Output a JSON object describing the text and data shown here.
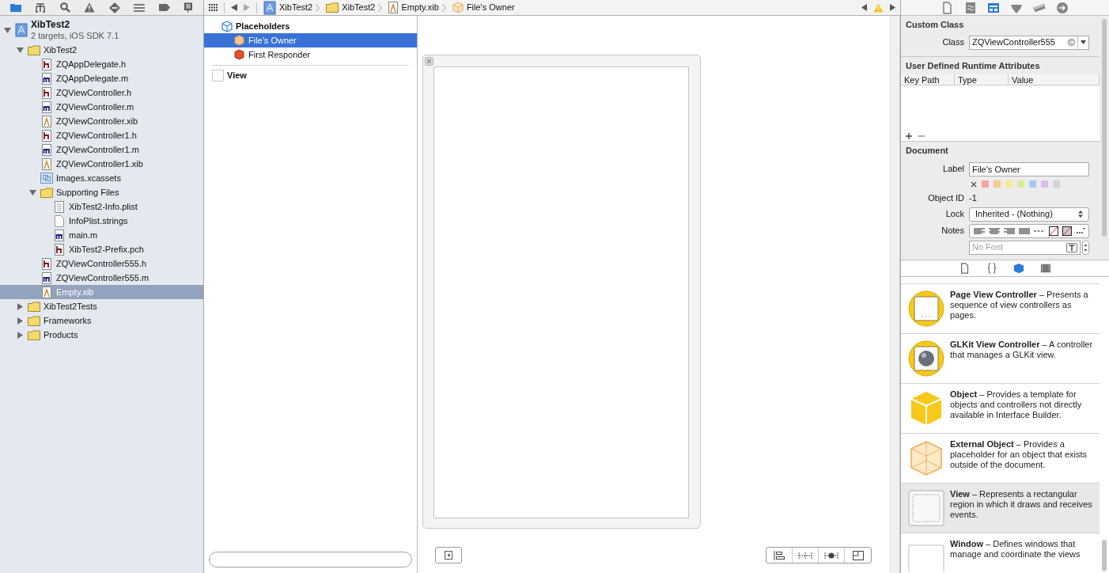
{
  "navigator": {
    "tree": [
      {
        "name": "XibTest2",
        "subtitle": "2 targets, iOS SDK 7.1",
        "kind": "project",
        "expanded": true,
        "selected": false,
        "children": [
          {
            "name": "XibTest2",
            "kind": "folder",
            "expanded": true,
            "selected": false,
            "children": [
              {
                "name": "ZQAppDelegate.h",
                "kind": "h",
                "selected": false
              },
              {
                "name": "ZQAppDelegate.m",
                "kind": "m",
                "selected": false
              },
              {
                "name": "ZQViewController.h",
                "kind": "h",
                "selected": false
              },
              {
                "name": "ZQViewController.m",
                "kind": "m",
                "selected": false
              },
              {
                "name": "ZQViewController.xib",
                "kind": "xib",
                "selected": false
              },
              {
                "name": "ZQViewController1.h",
                "kind": "h",
                "selected": false
              },
              {
                "name": "ZQViewController1.m",
                "kind": "m",
                "selected": false
              },
              {
                "name": "ZQViewController1.xib",
                "kind": "xib",
                "selected": false
              },
              {
                "name": "Images.xcassets",
                "kind": "assets",
                "selected": false
              },
              {
                "name": "Supporting Files",
                "kind": "folder",
                "expanded": true,
                "selected": false,
                "children": [
                  {
                    "name": "XibTest2-Info.plist",
                    "kind": "plist",
                    "selected": false
                  },
                  {
                    "name": "InfoPlist.strings",
                    "kind": "strings",
                    "selected": false
                  },
                  {
                    "name": "main.m",
                    "kind": "m",
                    "selected": false
                  },
                  {
                    "name": "XibTest2-Prefix.pch",
                    "kind": "h",
                    "selected": false
                  }
                ]
              },
              {
                "name": "ZQViewController555.h",
                "kind": "h",
                "selected": false
              },
              {
                "name": "ZQViewController555.m",
                "kind": "m",
                "selected": false
              },
              {
                "name": "Empty.xib",
                "kind": "xib",
                "selected": true
              }
            ]
          },
          {
            "name": "XibTest2Tests",
            "kind": "folder",
            "expanded": false,
            "selected": false
          },
          {
            "name": "Frameworks",
            "kind": "folder",
            "expanded": false,
            "selected": false
          },
          {
            "name": "Products",
            "kind": "folder",
            "expanded": false,
            "selected": false
          }
        ]
      }
    ]
  },
  "jump_bar": {
    "crumbs": [
      {
        "label": "XibTest2",
        "kind": "project"
      },
      {
        "label": "XibTest2",
        "kind": "folder"
      },
      {
        "label": "Empty.xib",
        "kind": "xib"
      },
      {
        "label": "File's Owner",
        "kind": "owner"
      }
    ]
  },
  "outline": {
    "sections": [
      {
        "title": "Placeholders",
        "kind": "placeholders",
        "items": [
          {
            "label": "File's Owner",
            "kind": "owner",
            "selected": true
          },
          {
            "label": "First Responder",
            "kind": "responder",
            "selected": false
          }
        ]
      },
      {
        "title": "View",
        "kind": "view"
      }
    ]
  },
  "inspector": {
    "tabs": [
      {
        "selected": false
      },
      {
        "selected": false
      },
      {
        "selected": true
      },
      {
        "selected": false
      },
      {
        "selected": false
      },
      {
        "selected": false
      }
    ],
    "custom_class": {
      "title": "Custom Class",
      "class_label": "Class",
      "class_value": "ZQViewController555"
    },
    "runtime_attributes": {
      "title": "User Defined Runtime Attributes",
      "columns": [
        "Key Path",
        "Type",
        "Value"
      ]
    },
    "document": {
      "title": "Document",
      "label_label": "Label",
      "label_value": "File's Owner",
      "label_colors": [
        {
          "color": "#f4a3a3"
        },
        {
          "color": "#f8c98f"
        },
        {
          "color": "#f3ec92"
        },
        {
          "color": "#d5e99b"
        },
        {
          "color": "#a0cbf4"
        },
        {
          "color": "#dcbdef"
        },
        {
          "color": "#d4d4d4"
        }
      ],
      "object_id_label": "Object ID",
      "object_id": "-1",
      "lock_label": "Lock",
      "lock_value": "Inherited - (Nothing)",
      "notes_label": "Notes",
      "font_placeholder": "No Font"
    }
  },
  "library": {
    "tabs": [
      {
        "selected": false
      },
      {
        "selected": false
      },
      {
        "selected": true
      },
      {
        "selected": false
      }
    ],
    "items": [
      {
        "title": "Page View Controller",
        "description": "– Presents a sequence of view controllers as pages.",
        "kind": "page",
        "selected": false
      },
      {
        "title": "GLKit View Controller",
        "description": "– A controller that manages a GLKit view.",
        "kind": "glkit",
        "selected": false
      },
      {
        "title": "Object",
        "description": "– Provides a template for objects and controllers not directly available in Interface Builder.",
        "kind": "object",
        "selected": false
      },
      {
        "title": "External Object",
        "description": "– Provides a placeholder for an object that exists outside of the document.",
        "kind": "external",
        "selected": false
      },
      {
        "title": "View",
        "description": "– Represents a rectangular region in which it draws and receives events.",
        "kind": "view",
        "selected": true
      },
      {
        "title": "Window",
        "description": "– Defines windows that manage and coordinate the views",
        "kind": "window",
        "selected": false
      }
    ]
  }
}
